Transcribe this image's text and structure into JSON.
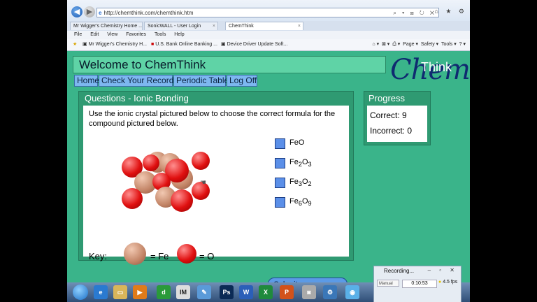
{
  "browser": {
    "address": "http://chemthink.com/chemthink.htm",
    "tabs": [
      {
        "label": "Mr Wigger's Chemistry Home ..."
      },
      {
        "label": "SonicWALL - User Login"
      },
      {
        "label": "ChemThink"
      }
    ],
    "menu": [
      "File",
      "Edit",
      "View",
      "Favorites",
      "Tools",
      "Help"
    ],
    "favorites": [
      {
        "label": "Mr Wigger's Chemistry H..."
      },
      {
        "label": "U.S. Bank Online Banking ..."
      },
      {
        "label": "Device Driver Update Soft..."
      }
    ],
    "command_bar": [
      "Page ▾",
      "Safety ▾",
      "Tools ▾"
    ]
  },
  "app": {
    "welcome": "Welcome to ChemThink",
    "logo_chem": "Chem",
    "logo_think": "Think",
    "nav": [
      "Home",
      "Check Your Records",
      "Periodic Table",
      "Log Off"
    ]
  },
  "question": {
    "heading": "Questions - Ionic Bonding",
    "text": "Use the ionic crystal pictured below to choose the correct formula for the compound pictured below.",
    "options": [
      {
        "base": "FeO",
        "parts": [
          "Fe",
          "",
          "O",
          ""
        ]
      },
      {
        "base": "Fe2O3",
        "parts": [
          "Fe",
          "2",
          "O",
          "3"
        ]
      },
      {
        "base": "Fe3O2",
        "parts": [
          "Fe",
          "3",
          "O",
          "2"
        ]
      },
      {
        "base": "Fe6O9",
        "parts": [
          "Fe",
          "6",
          "O",
          "9"
        ]
      }
    ],
    "key_label": "Key:",
    "key_fe": "= Fe",
    "key_o": "= O",
    "submit": "Submit your answer"
  },
  "progress": {
    "heading": "Progress",
    "correct_label": "Correct:",
    "correct_value": "9",
    "incorrect_label": "Incorrect:",
    "incorrect_value": "0"
  },
  "recorder": {
    "title": "Recording...",
    "mode": "Manual",
    "time": "0:10:53",
    "fps": "4.5 fps"
  },
  "colors": {
    "page_bg": "#3ab48a",
    "panel": "#2f9a72",
    "nav_button": "#7db7f0",
    "option_box": "#5b8fe8",
    "logo": "#0f2a70"
  }
}
